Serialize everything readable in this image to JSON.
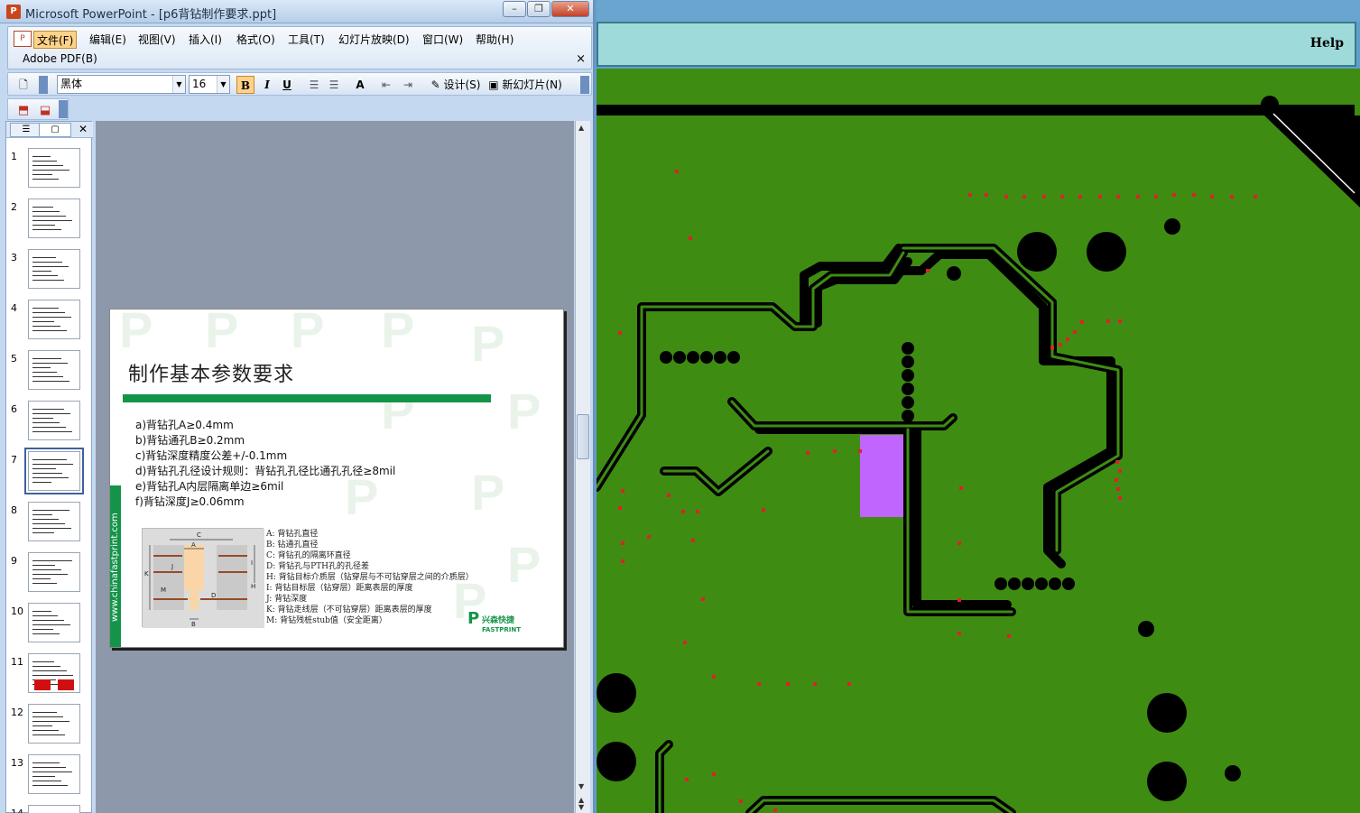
{
  "window": {
    "title": "Microsoft PowerPoint - [p6背钻制作要求.ppt]"
  },
  "menu": {
    "items": [
      "文件(F)",
      "编辑(E)",
      "视图(V)",
      "插入(I)",
      "格式(O)",
      "工具(T)",
      "幻灯片放映(D)",
      "窗口(W)",
      "帮助(H)"
    ],
    "adobe": "Adobe PDF(B)",
    "close": "×"
  },
  "toolbar": {
    "font": "黑体",
    "size": "16",
    "bold": "B",
    "italic": "I",
    "underline": "U",
    "design": "设计(S)",
    "new_slide": "新幻灯片(N)"
  },
  "thumbs": [
    "1",
    "2",
    "3",
    "4",
    "5",
    "6",
    "7",
    "8",
    "9",
    "10",
    "11",
    "12",
    "13",
    "14"
  ],
  "selected_thumb": 7,
  "slide": {
    "title": "制作基本参数要求",
    "items": [
      "a)背钻孔A≥0.4mm",
      "b)背钻通孔B≥0.2mm",
      "c)背钻深度精度公差+/-0.1mm",
      "d)背钻孔孔径设计规则：背钻孔孔径比通孔孔径≥8mil",
      "e)背钻孔A内层隔离单边≥6mil",
      "f)背钻深度J≥0.06mm"
    ],
    "legend": [
      "A: 背钻孔直径",
      "B: 钻通孔直径",
      "C: 背钻孔的隔离环直径",
      "D: 背钻孔与PTH孔的孔径差",
      "H: 背钻目标介质层（钻穿层与不可钻穿层之间的介质层）",
      "I: 背钻目标层（钻穿层）距离表层的厚度",
      "J: 背钻深度",
      "K: 背钻走线层（不可钻穿层）距离表层的厚度",
      "M: 背钻残桩stub值（安全距离）"
    ],
    "side_url": "www.chinafastprint.com",
    "logo_cn": "兴森快捷",
    "logo_en": "FASTPRINT"
  },
  "help": {
    "label": "Help"
  },
  "colors": {
    "pcb_green": "#3f8c13",
    "trace_black": "#000000",
    "highlight": "#c066ff",
    "slide_green": "#149449"
  }
}
